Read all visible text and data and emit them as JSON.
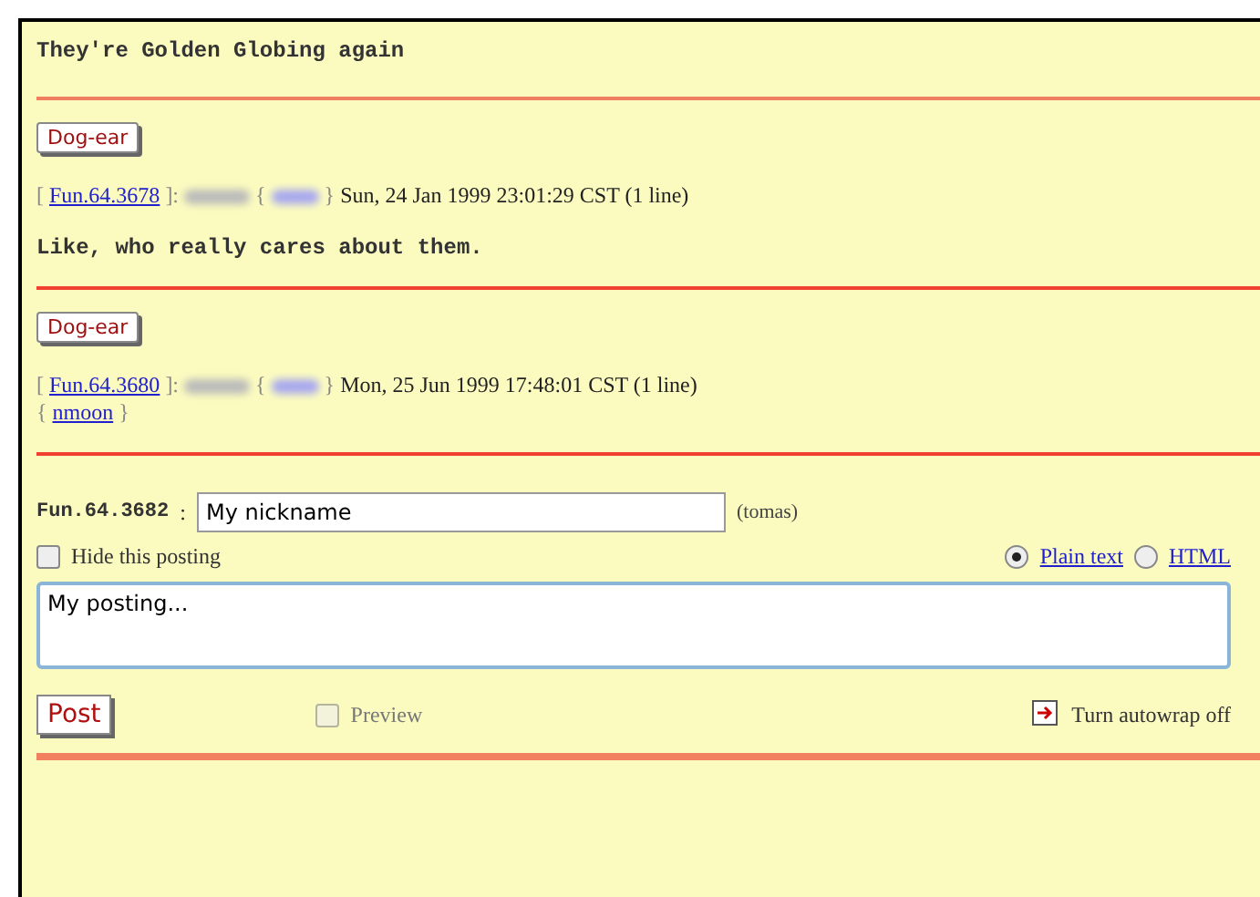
{
  "thread_title": "They're Golden Globing again",
  "posts": [
    {
      "dog_ear": "Dog-ear",
      "link_open": "[",
      "link": "Fun.64.3678",
      "link_close": "]:",
      "user_open": "{",
      "user_close": "}",
      "date": "Sun, 24 Jan 1999 23:01:29 CST (1 line)",
      "body": "Like, who really cares about them."
    },
    {
      "dog_ear": "Dog-ear",
      "link_open": "[",
      "link": "Fun.64.3680",
      "link_close": "]:",
      "user_open": "{",
      "user_close": "}",
      "date": "Mon, 25 Jun 1999 17:48:01 CST (1 line)",
      "reply_open": "{",
      "reply_link": "nmoon",
      "reply_close": "}"
    }
  ],
  "form": {
    "id_label": "Fun.64.3682",
    "separator": ":",
    "nickname": "My nickname",
    "login": "(tomas)",
    "hide": {
      "label": "Hide this posting",
      "checked": false
    },
    "formats": [
      {
        "label": "Plain text",
        "selected": true
      },
      {
        "label": "HTML",
        "selected": false
      }
    ],
    "posting": "My posting...",
    "post_button": "Post",
    "preview": {
      "label": "Preview",
      "checked": false,
      "disabled": true
    },
    "autowrap": "Turn autowrap off"
  }
}
